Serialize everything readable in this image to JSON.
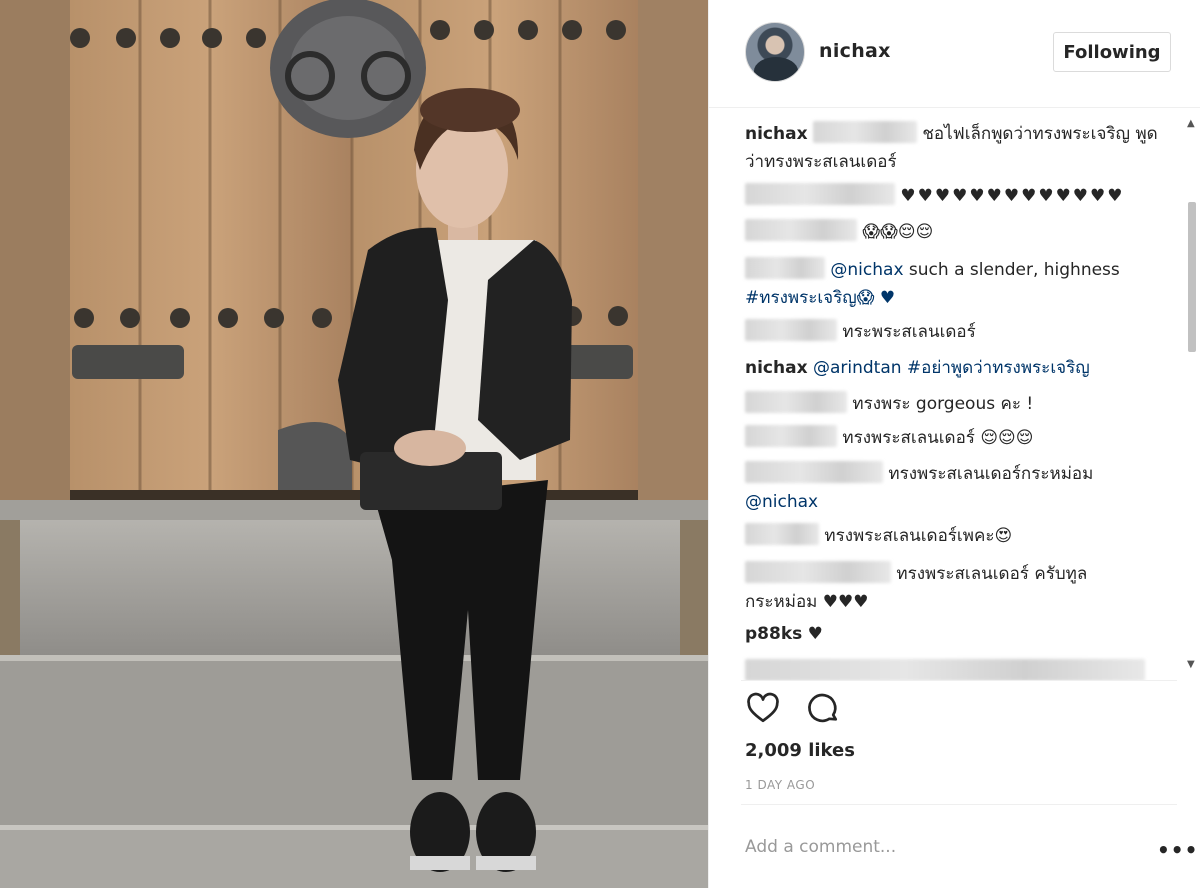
{
  "post": {
    "username": "nichax",
    "follow_label": "Following",
    "likes": "2,009 likes",
    "time": "1 DAY AGO",
    "add_comment_placeholder": "Add a comment...",
    "more_glyph": "•••"
  },
  "comments": [
    {
      "user": "nichax",
      "redacted": true,
      "text": "ชอไฟเล็กพูดว่าทรงพระเจริญ พูดว่าทรงพระสเลนเดอร์"
    },
    {
      "redacted": true,
      "text": "♥♥♥♥♥♥♥♥♥♥♥♥♥"
    },
    {
      "redacted": true,
      "text": "😱😱😌😌"
    },
    {
      "redacted": true,
      "mention": "@nichax",
      "text": "such a slender, highness",
      "line2": "#ทรงพระเจริญ😱 ♥"
    },
    {
      "redacted": true,
      "text": "ทระพระสเลนเดอร์"
    },
    {
      "user": "nichax",
      "mention": "@arindtan #อย่าพูดว่าทรงพระเจริญ"
    },
    {
      "redacted": true,
      "text": "ทรงพระ gorgeous คะ !"
    },
    {
      "redacted": true,
      "text": "ทรงพระสเลนเดอร์ 😌😌😌"
    },
    {
      "redacted": true,
      "text": "ทรงพระสเลนเดอร์กระหม่อม",
      "line2_mention": "@nichax"
    },
    {
      "redacted": true,
      "text": "ทรงพระสเลนเดอร์เพคะ😍"
    },
    {
      "redacted": true,
      "text": "ทรงพระสเลนเดอร์ ครับทูล",
      "line2": "กระหม่อม ♥♥♥"
    },
    {
      "user": "p88ks",
      "text": "♥"
    }
  ],
  "icons": {
    "heart": "heart-outline-icon",
    "comment": "comment-bubble-icon",
    "more": "more-horizontal-icon"
  }
}
